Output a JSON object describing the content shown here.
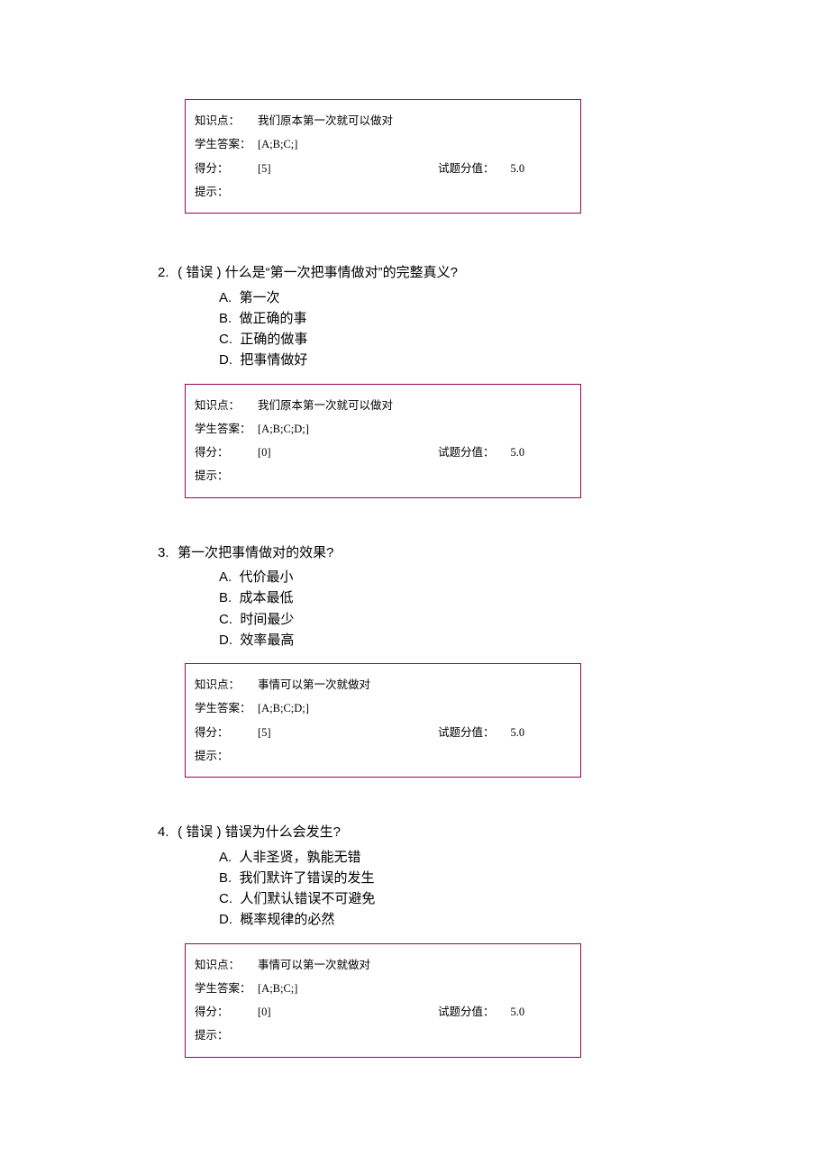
{
  "labels": {
    "knowledge": "知识点：",
    "studentAnswer": "学生答案：",
    "score": "得分：",
    "fullValue": "试题分值：",
    "hint": "提示："
  },
  "questions": [
    {
      "number": "",
      "status": "",
      "text": "",
      "options": {
        "A": "",
        "B": "",
        "C": "",
        "D": ""
      },
      "knowledge": "我们原本第一次就可以做对",
      "studentAnswer": "[A;B;C;]",
      "score": "[5]",
      "fullValue": "5.0",
      "hint": ""
    },
    {
      "number": "2.",
      "status": "( 错误 )",
      "text": "什么是“第一次把事情做对”的完整真义?",
      "options": {
        "A": "第一次",
        "B": "做正确的事",
        "C": "正确的做事",
        "D": "把事情做好"
      },
      "knowledge": "我们原本第一次就可以做对",
      "studentAnswer": "[A;B;C;D;]",
      "score": "[0]",
      "fullValue": "5.0",
      "hint": ""
    },
    {
      "number": "3.",
      "status": "",
      "text": "第一次把事情做对的效果?",
      "options": {
        "A": "代价最小",
        "B": "成本最低",
        "C": "时间最少",
        "D": "效率最高"
      },
      "knowledge": "事情可以第一次就做对",
      "studentAnswer": "[A;B;C;D;]",
      "score": "[5]",
      "fullValue": "5.0",
      "hint": ""
    },
    {
      "number": "4.",
      "status": "( 错误 )",
      "text": "错误为什么会发生?",
      "options": {
        "A": "人非圣贤，孰能无错",
        "B": "我们默许了错误的发生",
        "C": "人们默认错误不可避免",
        "D": "概率规律的必然"
      },
      "knowledge": "事情可以第一次就做对",
      "studentAnswer": "[A;B;C;]",
      "score": "[0]",
      "fullValue": "5.0",
      "hint": ""
    }
  ]
}
